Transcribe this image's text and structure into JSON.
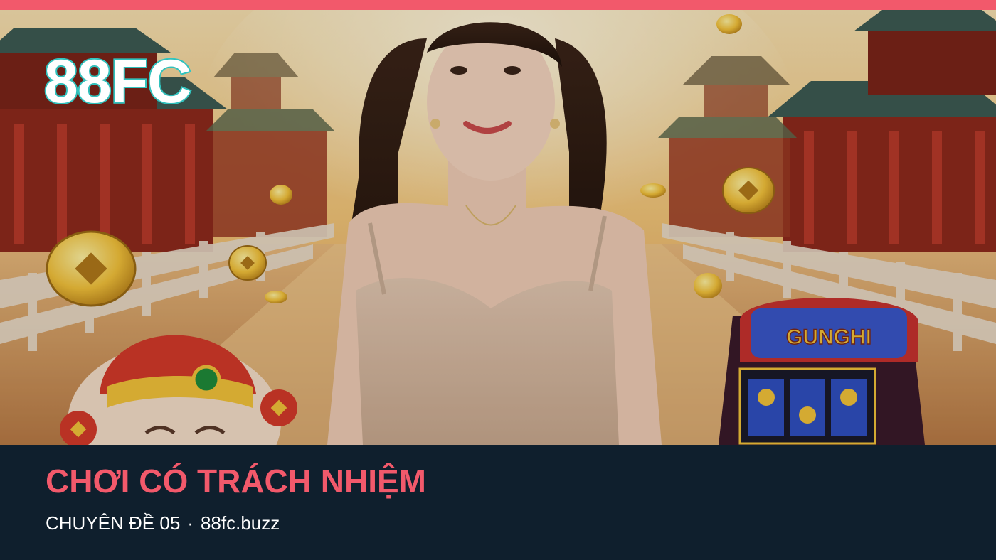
{
  "colors": {
    "accent": "#f2596b",
    "footer_bg": "#0f1f2d",
    "logo_fill": "#ffffff",
    "logo_outline": "#35c9c4"
  },
  "hero": {
    "brand_logo_text": "88FC",
    "slot_machine_marquee": "GUNGHI"
  },
  "footer": {
    "title": "CHƠI CÓ TRÁCH NHIỆM",
    "topic": "CHUYÊN ĐỀ 05",
    "separator": "·",
    "site": "88fc.buzz"
  }
}
